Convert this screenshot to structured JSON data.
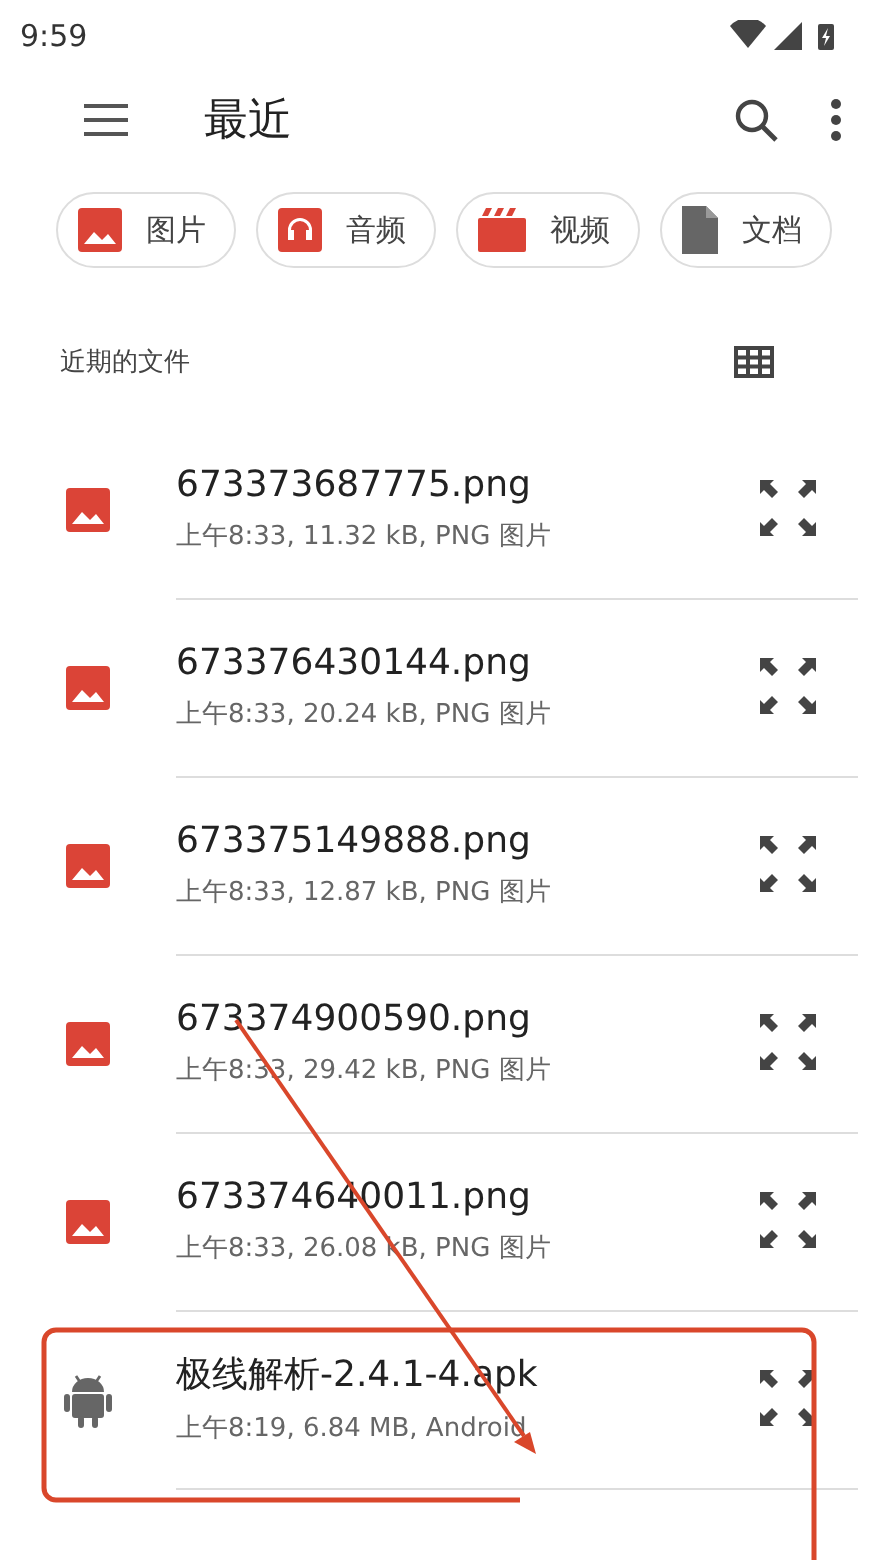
{
  "status_bar": {
    "time": "9:59"
  },
  "toolbar": {
    "title": "最近"
  },
  "chips": [
    {
      "label": "图片",
      "kind": "image"
    },
    {
      "label": "音频",
      "kind": "audio"
    },
    {
      "label": "视频",
      "kind": "video"
    },
    {
      "label": "文档",
      "kind": "doc"
    }
  ],
  "section": {
    "title": "近期的文件"
  },
  "files": [
    {
      "name": "673373687775.png",
      "meta": "上午8:33, 11.32 kB, PNG 图片",
      "kind": "image"
    },
    {
      "name": "673376430144.png",
      "meta": "上午8:33, 20.24 kB, PNG 图片",
      "kind": "image"
    },
    {
      "name": "673375149888.png",
      "meta": "上午8:33, 12.87 kB, PNG 图片",
      "kind": "image"
    },
    {
      "name": "673374900590.png",
      "meta": "上午8:33, 29.42 kB, PNG 图片",
      "kind": "image"
    },
    {
      "name": "673374640011.png",
      "meta": "上午8:33, 26.08 kB, PNG 图片",
      "kind": "image"
    },
    {
      "name": "极线解析-2.4.1-4.apk",
      "meta": "上午8:19, 6.84 MB, Android",
      "kind": "apk"
    }
  ]
}
